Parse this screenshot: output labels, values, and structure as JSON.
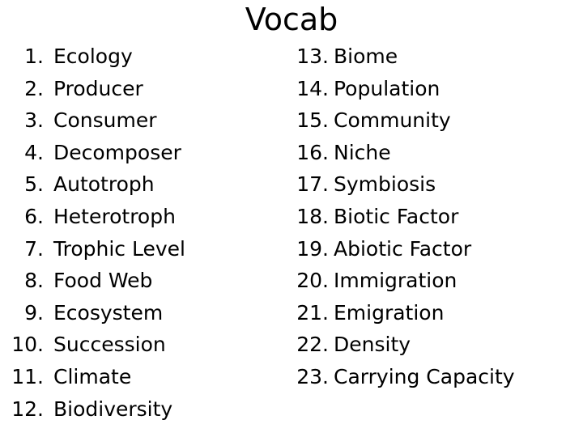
{
  "slide": {
    "title": "Vocab",
    "background_color": "#ffffff",
    "text_color": "#000000"
  },
  "columns": [
    {
      "name": "left",
      "items": [
        {
          "number": "1.",
          "term": "Ecology"
        },
        {
          "number": "2.",
          "term": "Producer"
        },
        {
          "number": "3.",
          "term": "Consumer"
        },
        {
          "number": "4.",
          "term": "Decomposer"
        },
        {
          "number": "5.",
          "term": "Autotroph"
        },
        {
          "number": "6.",
          "term": "Heterotroph"
        },
        {
          "number": "7.",
          "term": "Trophic Level"
        },
        {
          "number": "8.",
          "term": "Food Web"
        },
        {
          "number": "9.",
          "term": "Ecosystem"
        },
        {
          "number": "10.",
          "term": "Succession"
        },
        {
          "number": "11.",
          "term": "Climate"
        },
        {
          "number": "12.",
          "term": "Biodiversity"
        }
      ]
    },
    {
      "name": "right",
      "items": [
        {
          "number": "13.",
          "term": "Biome"
        },
        {
          "number": "14.",
          "term": "Population"
        },
        {
          "number": "15.",
          "term": "Community"
        },
        {
          "number": "16.",
          "term": "Niche"
        },
        {
          "number": "17.",
          "term": "Symbiosis"
        },
        {
          "number": "18.",
          "term": "Biotic Factor"
        },
        {
          "number": "19.",
          "term": "Abiotic Factor"
        },
        {
          "number": "20.",
          "term": "Immigration"
        },
        {
          "number": "21.",
          "term": "Emigration"
        },
        {
          "number": "22.",
          "term": "Density"
        },
        {
          "number": "23.",
          "term": "Carrying Capacity"
        }
      ]
    }
  ]
}
